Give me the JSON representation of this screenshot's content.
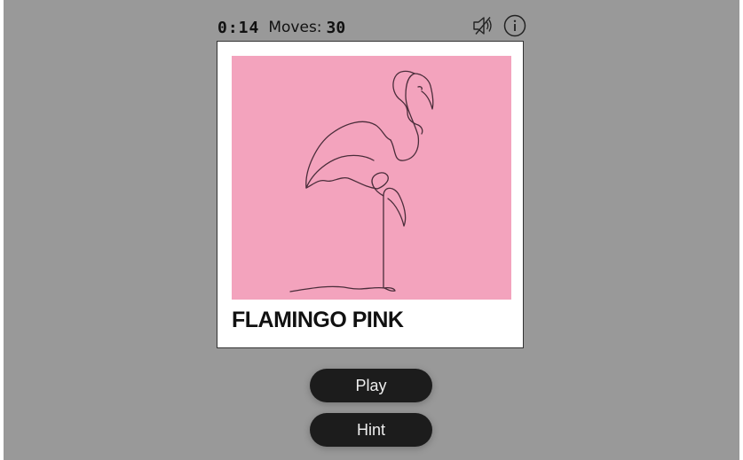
{
  "stats": {
    "timer": "0:14",
    "moves_label": "Moves:",
    "moves_value": "30"
  },
  "icons": {
    "mute": "speaker-muted-icon",
    "info": "info-circle-icon"
  },
  "puzzle": {
    "color_name": "FLAMINGO PINK",
    "swatch_color": "#f3a3bd",
    "illustration": "flamingo-line-drawing"
  },
  "buttons": {
    "play_label": "Play",
    "hint_label": "Hint"
  },
  "colors": {
    "background": "#999999",
    "button_bg": "#1c1c1c",
    "button_text": "#eeeeee"
  }
}
